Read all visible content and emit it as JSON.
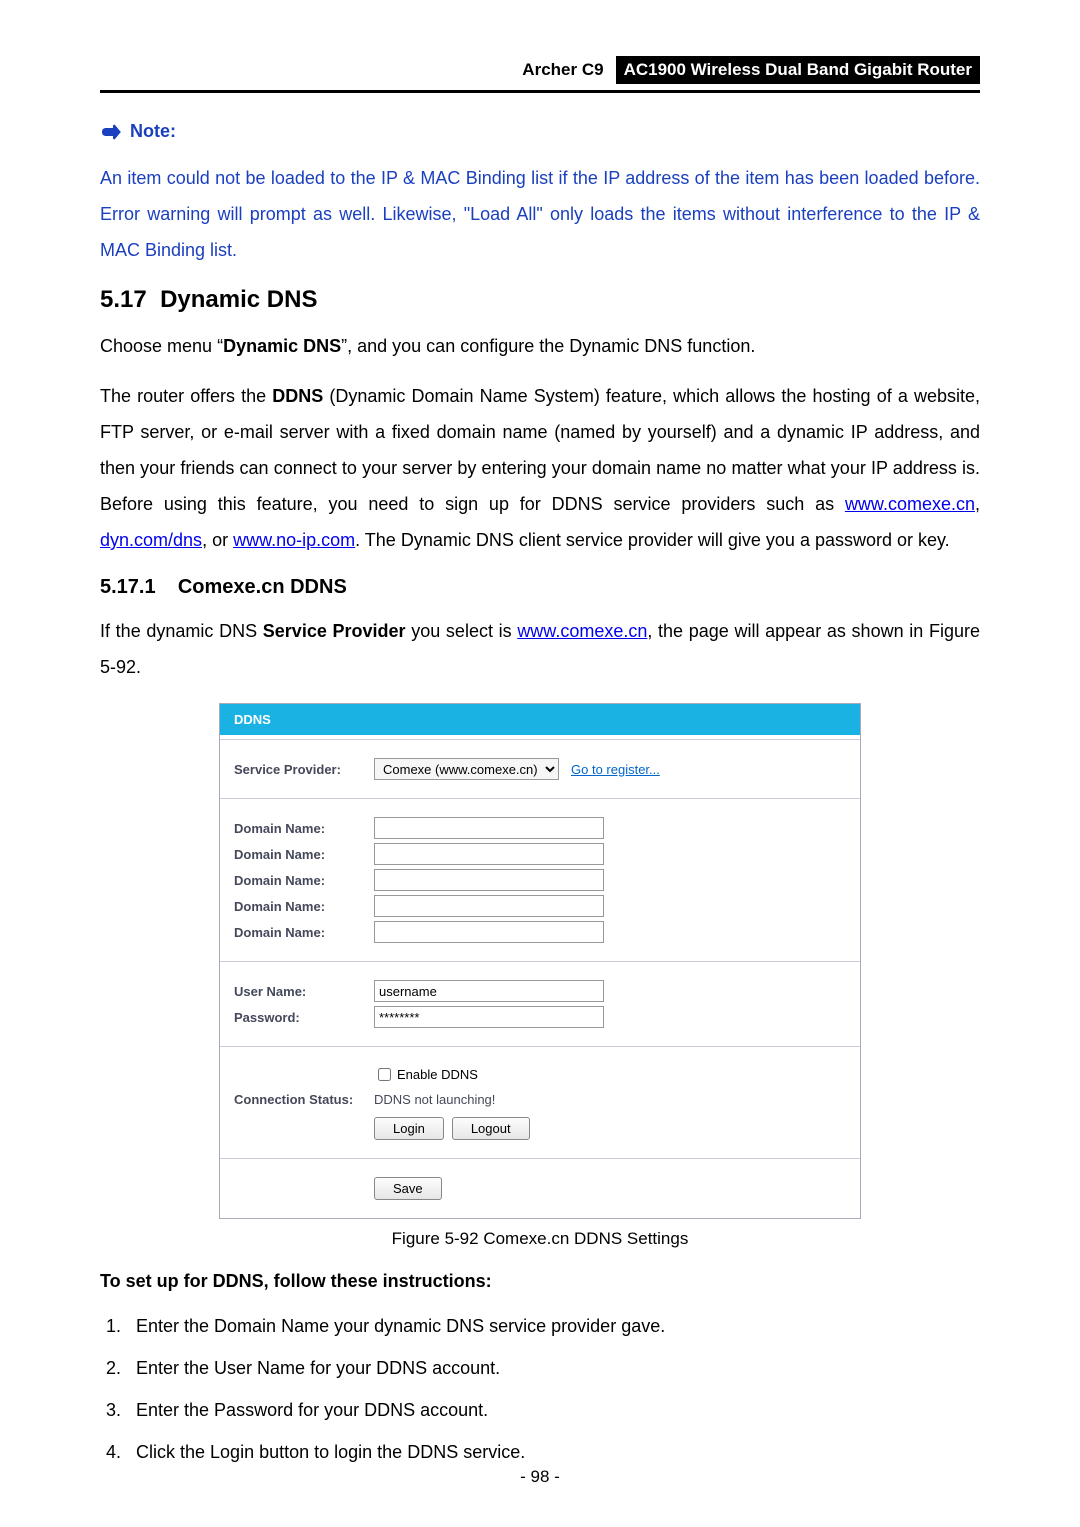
{
  "header": {
    "model": "Archer C9",
    "product": "AC1900 Wireless Dual Band Gigabit Router"
  },
  "note": {
    "title": "Note:",
    "body": "An item could not be loaded to the IP & MAC Binding list if the IP address of the item has been loaded before. Error warning will prompt as well. Likewise, \"Load All\" only loads the items without interference to the IP & MAC Binding list."
  },
  "section": {
    "number": "5.17",
    "title": "Dynamic DNS",
    "intro_pre": "Choose menu “",
    "intro_bold": "Dynamic DNS",
    "intro_post": "”, and you can configure the Dynamic DNS function.",
    "p2_a": "The router offers the ",
    "p2_b": "DDNS",
    "p2_c": " (Dynamic Domain Name System) feature, which allows the hosting of a website, FTP server, or e-mail server with a fixed domain name (named by yourself) and a dynamic IP address, and then your friends can connect to your server by entering your domain name no matter what your IP address is. Before using this feature, you need to sign up for DDNS service providers such as ",
    "p2_link1": "www.comexe.cn",
    "p2_sep1": ", ",
    "p2_link2": "dyn.com/dns",
    "p2_sep2": ", or ",
    "p2_link3": "www.no-ip.com",
    "p2_d": ". The Dynamic DNS client service provider will give you a password or key."
  },
  "subsection": {
    "number": "5.17.1",
    "title": "Comexe.cn DDNS",
    "p_a": "If the dynamic DNS ",
    "p_bold": "Service Provider",
    "p_b": " you select is ",
    "p_link": "www.comexe.cn",
    "p_c": ", the page will appear as shown in Figure 5-92."
  },
  "figure": {
    "panel_title": "DDNS",
    "labels": {
      "service_provider": "Service Provider:",
      "domain_name": "Domain Name:",
      "user_name": "User Name:",
      "password": "Password:",
      "connection_status": "Connection Status:"
    },
    "provider_selected": "Comexe (www.comexe.cn)",
    "register_link": "Go to register...",
    "username_value": "username",
    "password_value": "********",
    "enable_label": "Enable DDNS",
    "status_text": "DDNS not launching!",
    "btn_login": "Login",
    "btn_logout": "Logout",
    "btn_save": "Save",
    "caption": "Figure 5-92 Comexe.cn DDNS Settings"
  },
  "instructions": {
    "heading": "To set up for DDNS, follow these instructions:",
    "items": [
      {
        "pre": "Enter the ",
        "bold": "Domain Name",
        "post": " your dynamic DNS service provider gave."
      },
      {
        "pre": "Enter the ",
        "bold": "User Name",
        "post": " for your DDNS account."
      },
      {
        "pre": "Enter the ",
        "bold": "Password",
        "post": " for your DDNS account."
      },
      {
        "pre": "Click the ",
        "bold": "Login",
        "post": " button to login the DDNS service."
      }
    ]
  },
  "page_number": "- 98 -"
}
